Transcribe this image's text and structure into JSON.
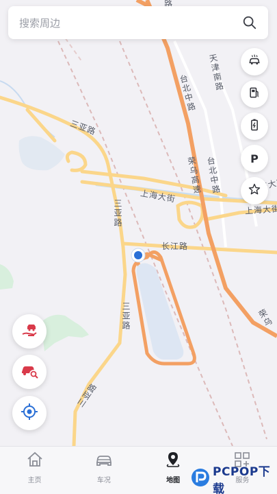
{
  "search": {
    "placeholder": "搜索周边"
  },
  "map_labels": {
    "sanya_road_top": "三亚路",
    "sanya_road_bottom": "三亚路",
    "sanya_road_left": "三亚路",
    "sanya_road_mid": "三亚路",
    "shanghai_ave_left": "上海大街",
    "shanghai_ave_right": "上海大街",
    "shanghai_ave_top_right": "上海大街",
    "changjiang_road": "长江路",
    "taibei_middle_road_1": "台北中路",
    "taibei_middle_road_2": "台北中路",
    "tianjin_south_road": "天津南路",
    "rongwu_highway": "荣乌高速",
    "rongwu_edge": "荣乌",
    "top_edge_road": "路"
  },
  "right_buttons": [
    {
      "name": "car-service",
      "icon": "car-service-icon"
    },
    {
      "name": "gas-station",
      "icon": "gas-pump-icon"
    },
    {
      "name": "charging",
      "icon": "battery-charge-icon"
    },
    {
      "name": "parking",
      "icon": "parking-icon",
      "label": "P"
    },
    {
      "name": "favorites",
      "icon": "star-icon"
    }
  ],
  "left_buttons": [
    {
      "name": "hand-car",
      "icon": "hand-car-icon"
    },
    {
      "name": "car-search",
      "icon": "car-search-icon"
    },
    {
      "name": "locate",
      "icon": "locate-icon"
    }
  ],
  "nav": [
    {
      "label": "主页",
      "icon": "home-icon",
      "active": false
    },
    {
      "label": "车况",
      "icon": "car-icon",
      "active": false
    },
    {
      "label": "地图",
      "icon": "map-pin-icon",
      "active": true
    },
    {
      "label": "服务",
      "icon": "apps-icon",
      "active": false
    }
  ],
  "watermark": {
    "text": "PCPOP下载"
  },
  "colors": {
    "highway": "#f3a063",
    "major_road": "#fbd68a",
    "water": "#dce9f6",
    "green": "#d8efdd",
    "accent_red": "#d93a4a",
    "accent_blue": "#2a6fd6"
  }
}
